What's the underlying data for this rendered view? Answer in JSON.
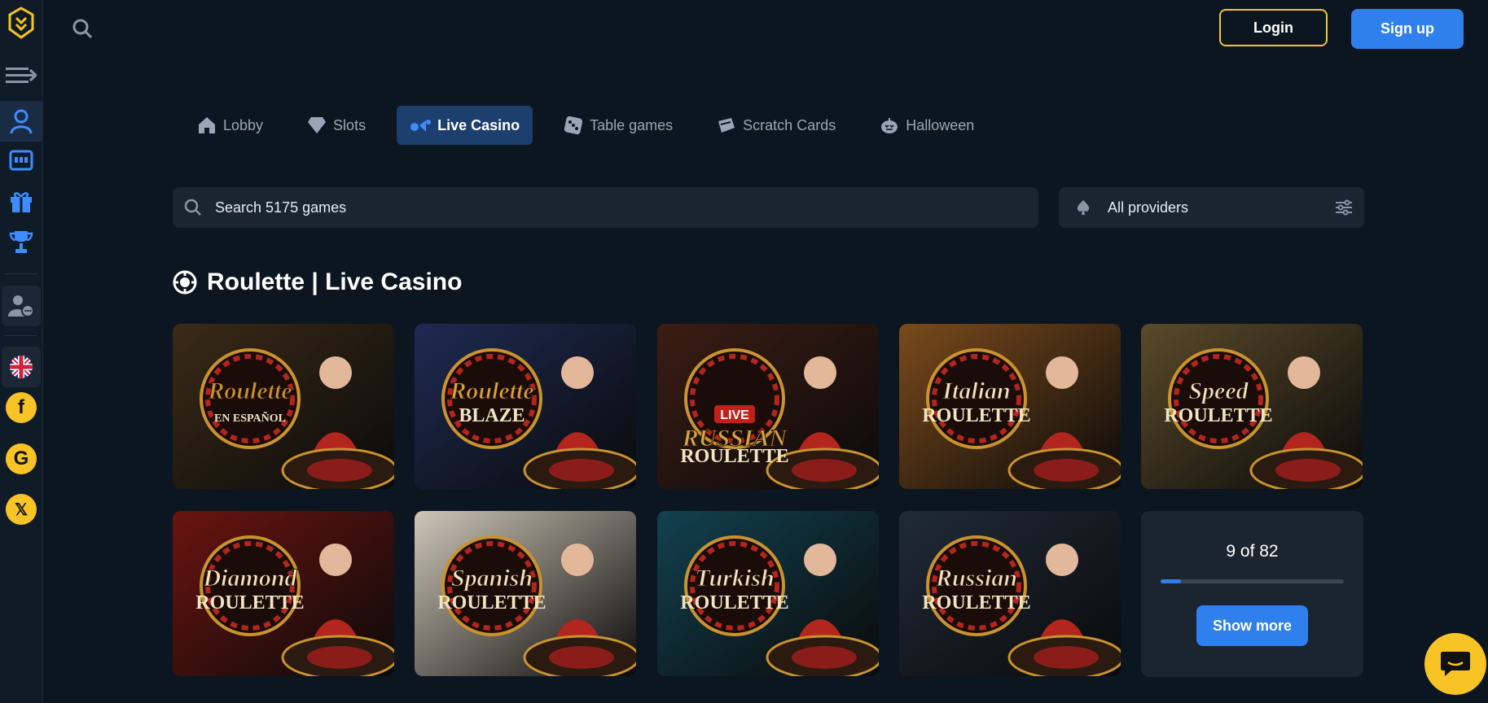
{
  "header": {
    "login_label": "Login",
    "signup_label": "Sign up"
  },
  "sidebar": {
    "icons": [
      "logo-icon",
      "menu-toggle-icon",
      "live-dealer-icon",
      "slot-machine-icon",
      "gift-icon",
      "trophy-icon",
      "support-chat-icon",
      "uk-flag-icon",
      "facebook-icon",
      "google-icon",
      "x-icon"
    ],
    "social": {
      "facebook": "f",
      "google": "G",
      "x": "𝕏"
    }
  },
  "tabs": [
    {
      "label": "Lobby",
      "icon": "home-icon",
      "active": false
    },
    {
      "label": "Slots",
      "icon": "diamond-icon",
      "active": false
    },
    {
      "label": "Live Casino",
      "icon": "live-casino-icon",
      "active": true
    },
    {
      "label": "Table games",
      "icon": "dice-icon",
      "active": false
    },
    {
      "label": "Scratch Cards",
      "icon": "scratch-card-icon",
      "active": false
    },
    {
      "label": "Halloween",
      "icon": "pumpkin-icon",
      "active": false
    }
  ],
  "search": {
    "placeholder": "Search 5175 games"
  },
  "providers": {
    "label": "All providers"
  },
  "section": {
    "title": "Roulette | Live Casino",
    "icon": "roulette-icon"
  },
  "games": [
    {
      "title": "Roulette",
      "subtitle": "EN ESPAÑOL",
      "bg": "#3a2a18",
      "accent": "#c9932e"
    },
    {
      "title": "Roulette",
      "subtitle": "BLAZE",
      "bg": "#1e2a52",
      "accent": "#d5a23a"
    },
    {
      "title": "RUSSIAN",
      "subtitle": "ROULETTE",
      "badge": "LIVE",
      "bg": "#3b1d14",
      "accent": "#d7a647"
    },
    {
      "title": "Italian",
      "subtitle": "ROULETTE",
      "bg": "#7a4a1c",
      "accent": "#f2e4c2"
    },
    {
      "title": "Speed",
      "subtitle": "ROULETTE",
      "bg": "#5a4a2a",
      "accent": "#f2e4c2"
    },
    {
      "title": "Diamond",
      "subtitle": "ROULETTE",
      "bg": "#6a1410",
      "accent": "#f2e4c2"
    },
    {
      "title": "Spanish",
      "subtitle": "ROULETTE",
      "bg": "#cfc6b8",
      "accent": "#f2e4c2"
    },
    {
      "title": "Turkish",
      "subtitle": "ROULETTE",
      "bg": "#12414f",
      "accent": "#f2e4c2"
    },
    {
      "title": "Russian",
      "subtitle": "ROULETTE",
      "bg": "#202a38",
      "accent": "#f2e4c2"
    }
  ],
  "pagination": {
    "count_text": "9 of 82",
    "progress": 0.11,
    "show_more_label": "Show more"
  },
  "colors": {
    "accent": "#2f80ed",
    "brand_yellow": "#f7c325",
    "bg": "#0c1621"
  }
}
